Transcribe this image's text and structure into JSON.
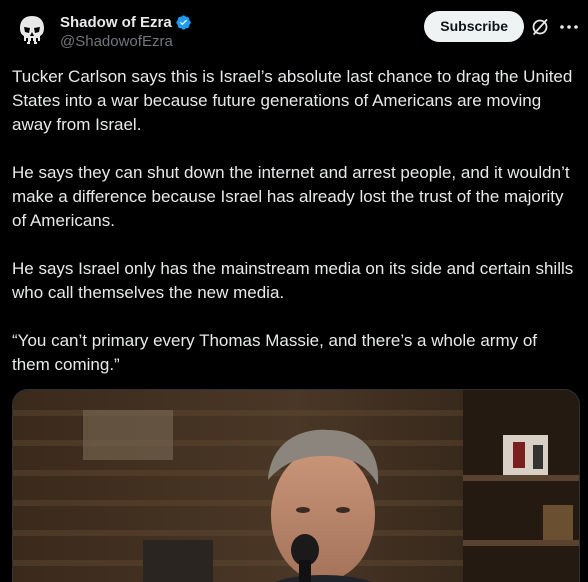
{
  "author": {
    "display_name": "Shadow of Ezra",
    "handle": "@ShadowofEzra",
    "verified": true,
    "avatar_icon": "skull-icon",
    "verified_color": "#1d9bf0"
  },
  "actions": {
    "subscribe_label": "Subscribe",
    "grok_icon": "grok-slash-icon",
    "more_icon": "more-dots-icon"
  },
  "post": {
    "paragraphs": [
      "Tucker Carlson says this is Israel’s absolute last chance to drag the United States into a war because future generations of Americans are moving away from Israel.",
      "He says they can shut down the internet and arrest people, and it wouldn’t make a difference because Israel has already lost the trust of the majority of Americans.",
      "He says Israel only has the mainstream media on its side and certain shills who call themselves the new media.",
      "“You can’t primary every Thomas Massie, and there’s a whole army of them coming.”"
    ]
  },
  "media": {
    "type": "video-thumbnail",
    "description_icon": "video-thumbnail"
  },
  "colors": {
    "background": "#000000",
    "text": "#e7e9ea",
    "secondary_text": "#71767b",
    "button_bg": "#eff3f4"
  }
}
